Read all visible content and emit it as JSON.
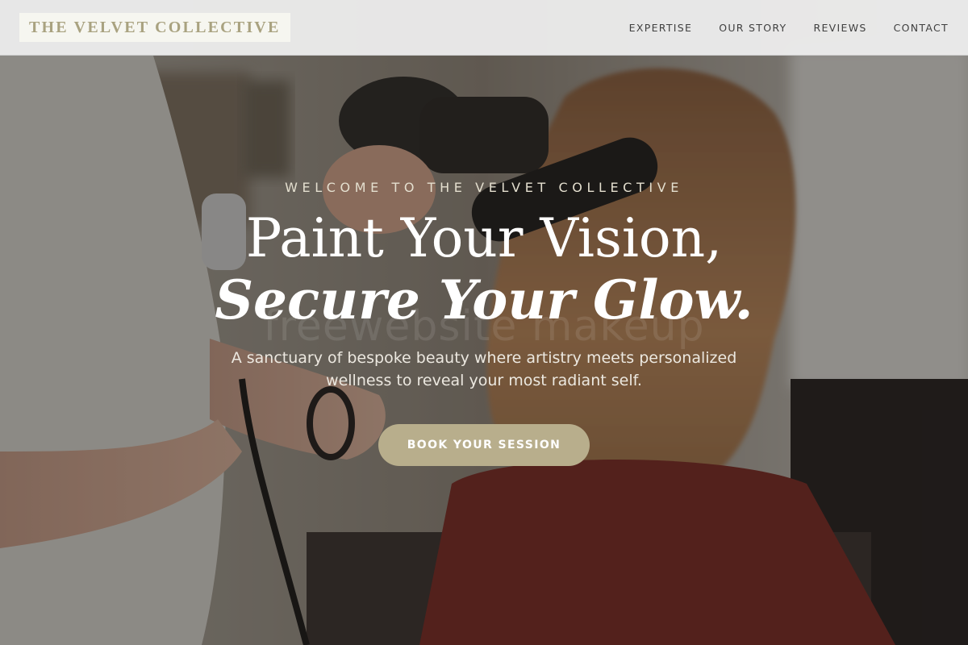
{
  "header": {
    "logo_text": "THE VELVET COLLECTIVE",
    "nav": [
      {
        "label": "EXPERTISE"
      },
      {
        "label": "OUR STORY"
      },
      {
        "label": "REVIEWS"
      },
      {
        "label": "CONTACT"
      }
    ]
  },
  "hero": {
    "eyebrow": "WELCOME TO THE VELVET COLLECTIVE",
    "headline_line1": "Paint Your Vision,",
    "headline_line2": "Secure Your Glow.",
    "watermark": "freewebsite makeup",
    "subtext": "A sanctuary of bespoke beauty where artistry meets personalized wellness to reveal your most radiant self.",
    "cta_label": "BOOK YOUR SESSION"
  },
  "colors": {
    "accent": "#b8ae8c",
    "logo_text": "#a9a280",
    "header_bg": "#ececec",
    "nav_text": "#3f3f3f"
  }
}
